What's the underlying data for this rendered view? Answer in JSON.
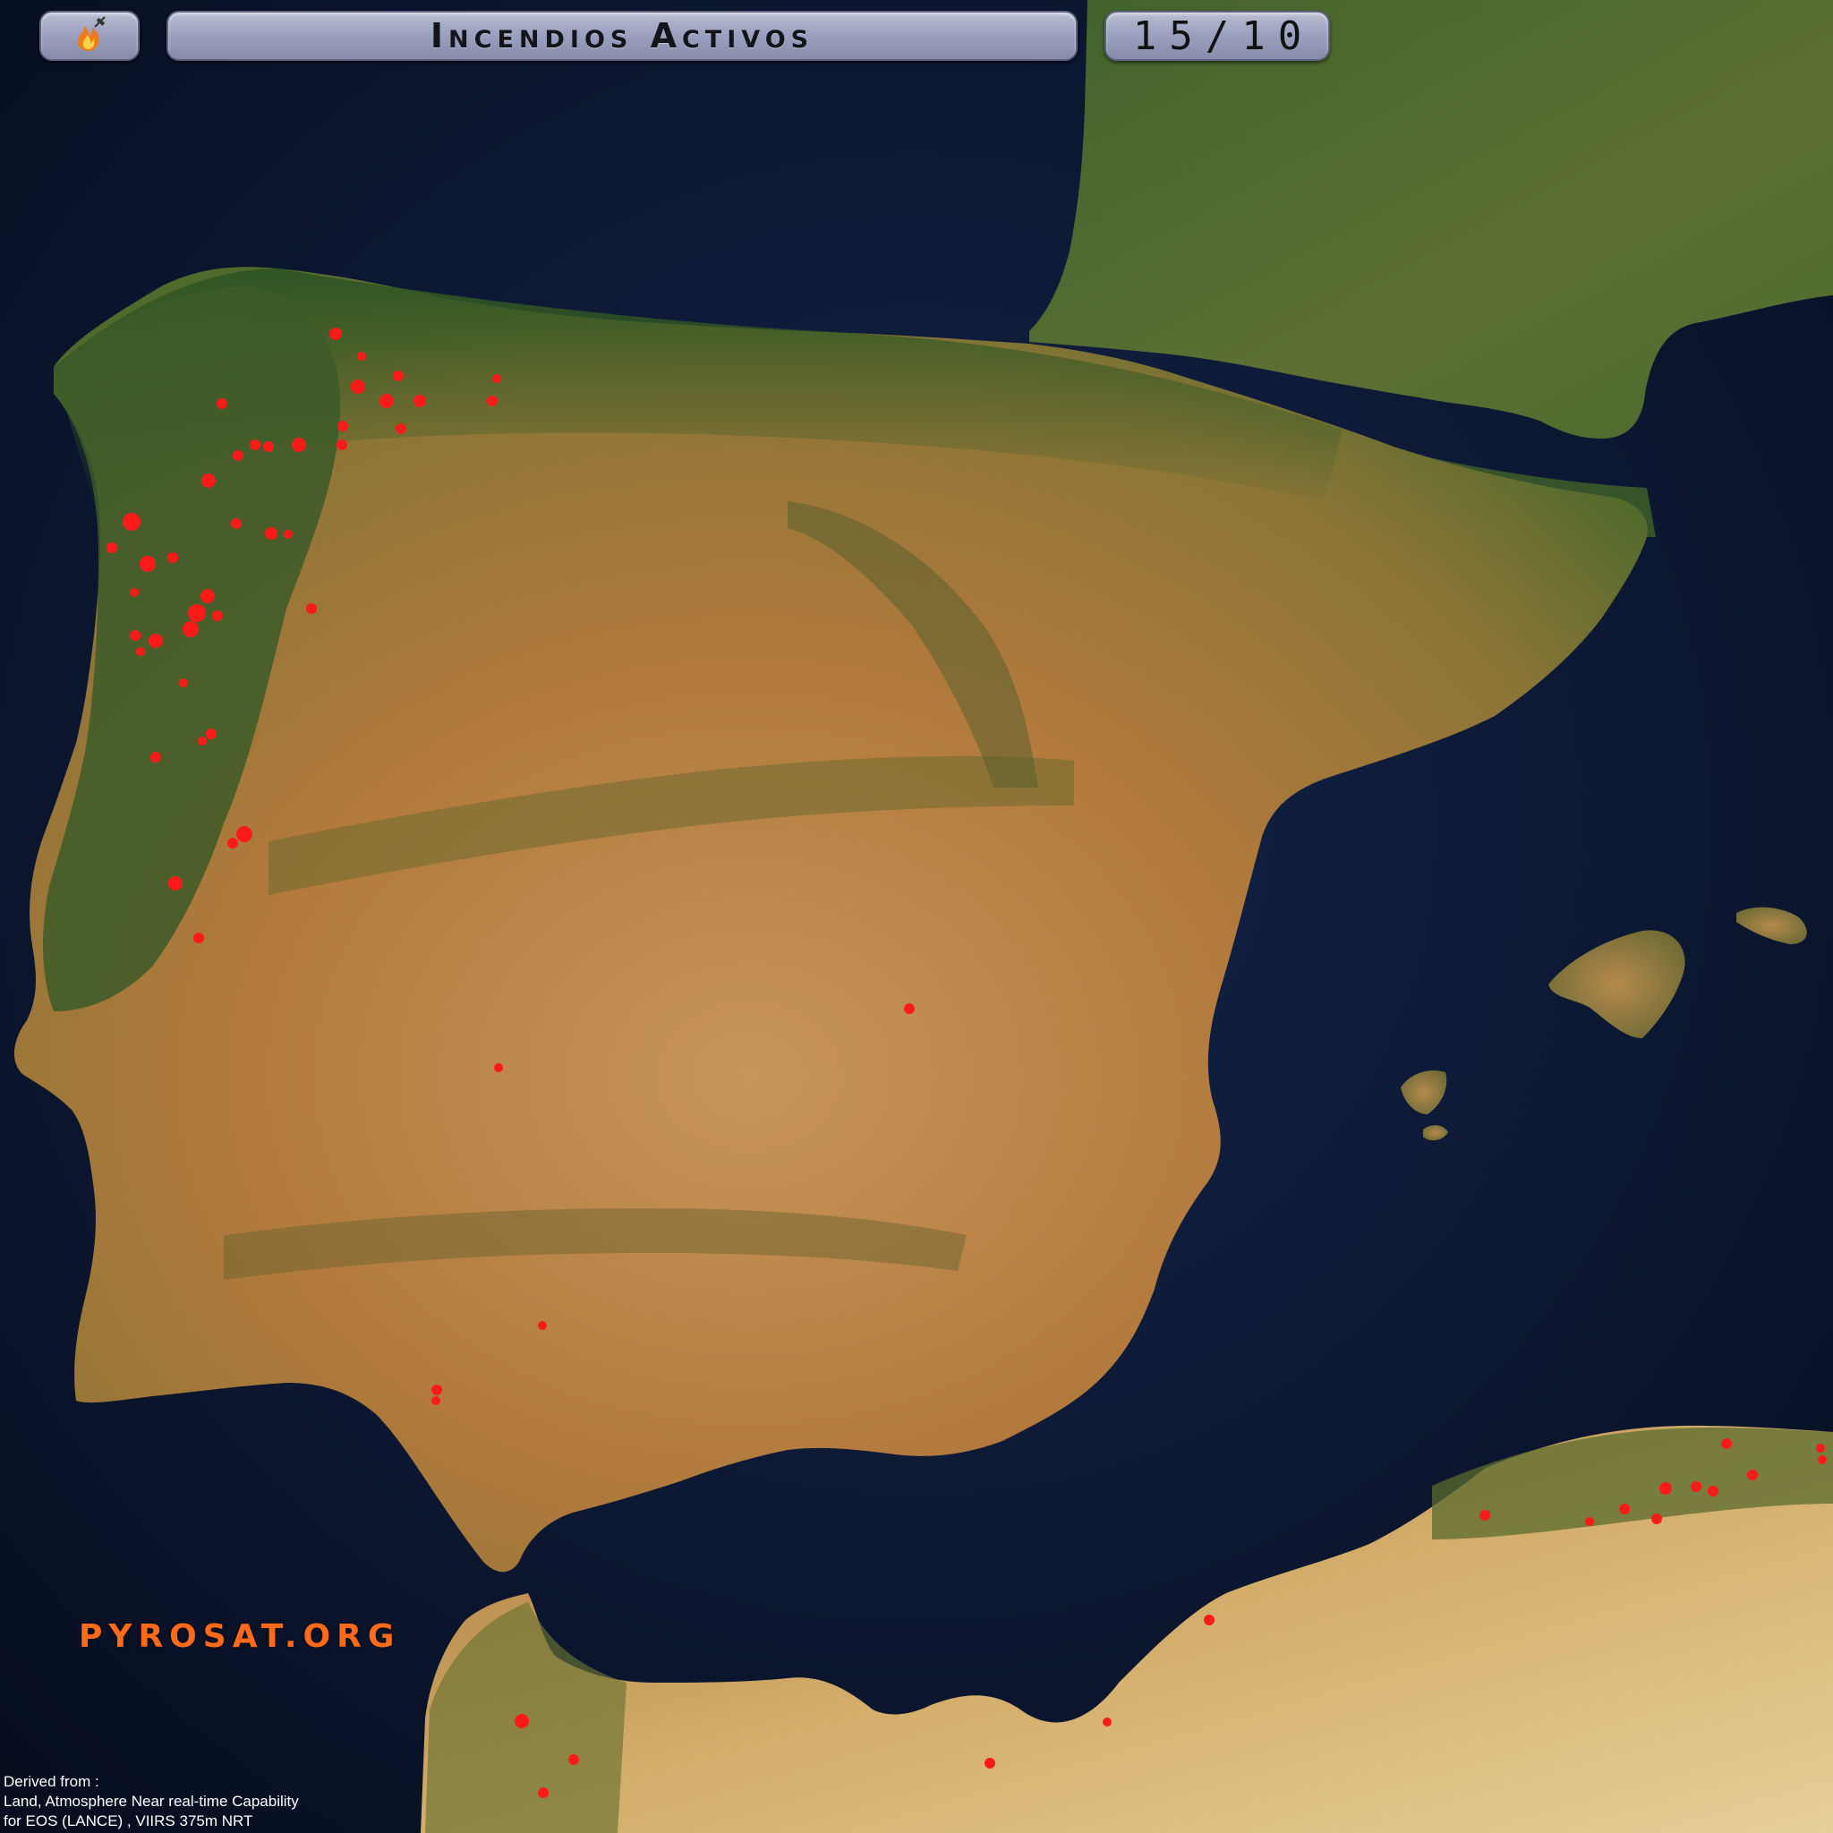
{
  "header": {
    "title": "Incendios Activos",
    "date": "15/10",
    "logo_icon": "flame-satellite-icon"
  },
  "brand": "PYROSAT.ORG",
  "credits": {
    "line1": "Derived from :",
    "line2": "Land, Atmosphere Near real-time Capability",
    "line3": "for EOS (LANCE) , VIIRS 375m NRT"
  },
  "colors": {
    "fire": "#ff1a1a",
    "sea": "#0b1630",
    "land_green": "#3f5d2a",
    "land_ochre": "#b8863f",
    "brand": "#ff6a1a"
  },
  "map": {
    "region": "Iberian Peninsula, southern France, Balearic Islands, northern Morocco and Algeria",
    "layer": "VIIRS 375m active fire detections"
  }
}
